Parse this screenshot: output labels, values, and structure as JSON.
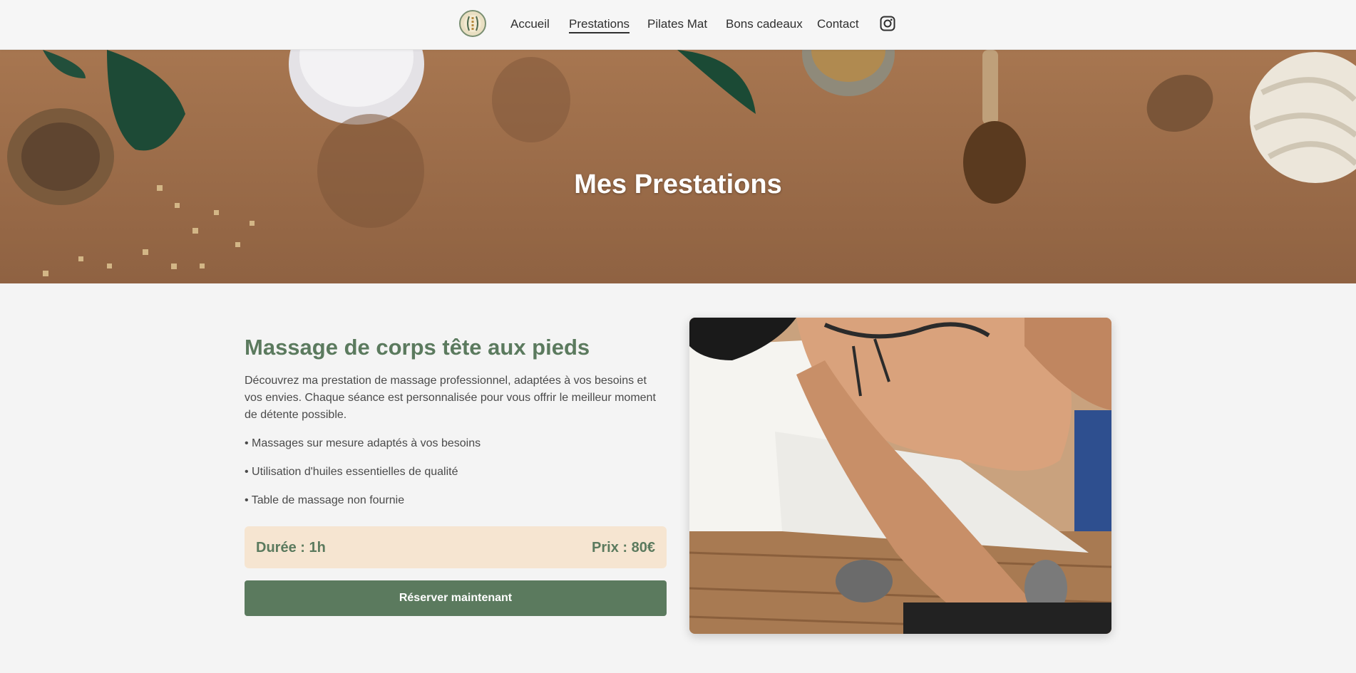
{
  "nav": {
    "logo": "site-logo",
    "links": [
      "Accueil",
      "Prestations",
      "Pilates Mat",
      "Bons cadeaux",
      "Contact"
    ],
    "active": "Prestations",
    "social_icon": "instagram-icon"
  },
  "hero": {
    "title": "Mes Prestations",
    "image": "spa-products-flatlay"
  },
  "service": {
    "title": "Massage de corps tête aux pieds",
    "description": "Découvrez ma prestation de massage professionnel, adaptées à vos besoins et vos envies. Chaque séance est personnalisée pour vous offrir le meilleur moment de détente possible.",
    "features": [
      "• Massages sur mesure adaptés à vos besoins",
      "• Utilisation d'huiles essentielles de qualité",
      "• Table de massage non fournie"
    ],
    "duration": "Durée : 1h",
    "price": "Prix : 80€",
    "cta": "Réserver maintenant",
    "image": "back-massage-photo"
  },
  "colors": {
    "accent_green": "#5b7a5e",
    "price_box_bg": "#f6e5d1",
    "hero_brown": "#9c6d49",
    "page_bg": "#f4f4f4"
  }
}
